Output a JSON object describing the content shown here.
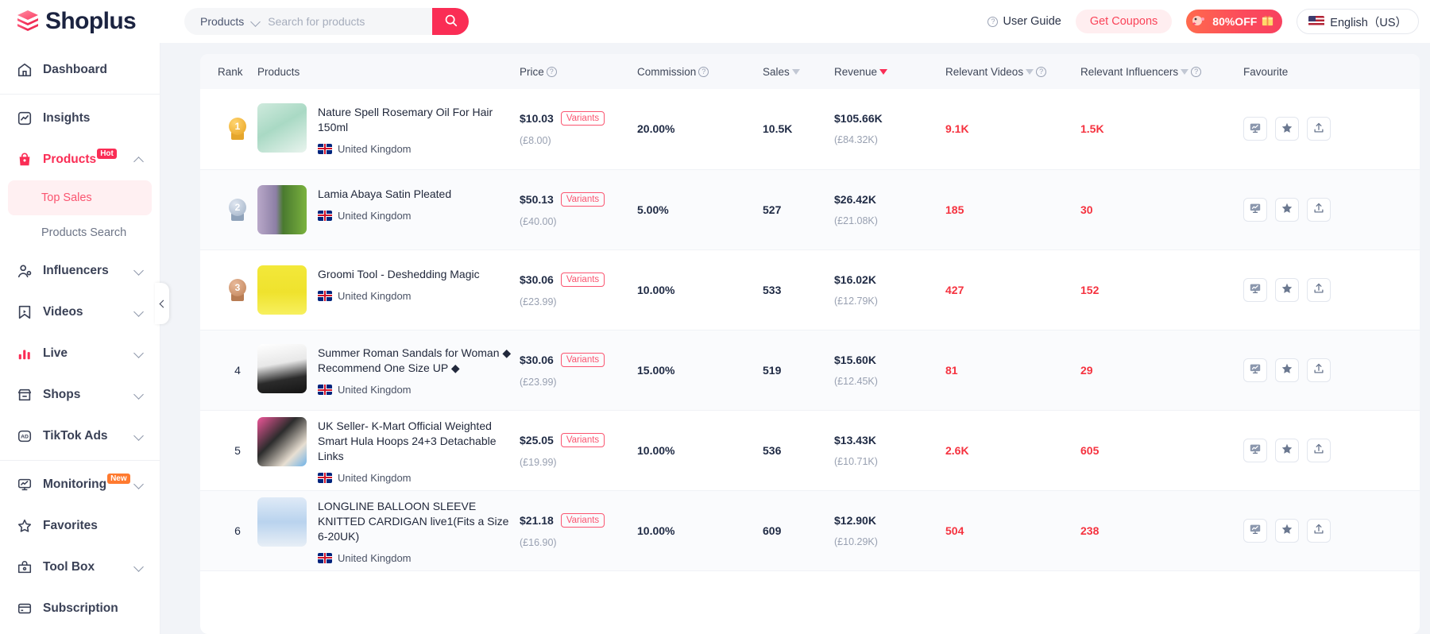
{
  "brand": {
    "name": "Shoplus"
  },
  "search": {
    "category": "Products",
    "placeholder": "Search for products",
    "value": "",
    "button_icon": "search-icon"
  },
  "header": {
    "user_guide": "User Guide",
    "get_coupons": "Get Coupons",
    "offer": "80%OFF",
    "language": "English（US）"
  },
  "sidebar": {
    "items": [
      {
        "label": "Dashboard",
        "icon": "home-icon",
        "badge": null,
        "expandable": false
      },
      {
        "label": "Insights",
        "icon": "insights-icon",
        "badge": null,
        "expandable": false
      },
      {
        "label": "Products",
        "icon": "bag-icon",
        "badge": "Hot",
        "expandable": true,
        "expanded": true,
        "active": true
      },
      {
        "label": "Influencers",
        "icon": "user-icon",
        "badge": null,
        "expandable": true
      },
      {
        "label": "Videos",
        "icon": "video-icon",
        "badge": null,
        "expandable": true
      },
      {
        "label": "Live",
        "icon": "live-bars-icon",
        "badge": null,
        "expandable": true
      },
      {
        "label": "Shops",
        "icon": "shop-icon",
        "badge": null,
        "expandable": true
      },
      {
        "label": "TikTok Ads",
        "icon": "ad-icon",
        "badge": null,
        "expandable": true
      },
      {
        "label": "Monitoring",
        "icon": "monitor-icon",
        "badge": "New",
        "expandable": true
      },
      {
        "label": "Favorites",
        "icon": "star-outline-icon",
        "badge": null,
        "expandable": false
      },
      {
        "label": "Tool Box",
        "icon": "toolbox-icon",
        "badge": null,
        "expandable": true
      },
      {
        "label": "Subscription",
        "icon": "card-icon",
        "badge": null,
        "expandable": false
      }
    ],
    "subitems": [
      {
        "label": "Top Sales",
        "selected": true
      },
      {
        "label": "Products Search",
        "selected": false
      }
    ]
  },
  "table": {
    "columns": [
      {
        "key": "rank",
        "label": "Rank",
        "help": false,
        "sort": null
      },
      {
        "key": "products",
        "label": "Products",
        "help": false,
        "sort": null
      },
      {
        "key": "price",
        "label": "Price",
        "help": true,
        "sort": null
      },
      {
        "key": "commission",
        "label": "Commission",
        "help": true,
        "sort": null
      },
      {
        "key": "sales",
        "label": "Sales",
        "help": false,
        "sort": "inactive"
      },
      {
        "key": "revenue",
        "label": "Revenue",
        "help": false,
        "sort": "active-desc"
      },
      {
        "key": "relevant_videos",
        "label": "Relevant Videos",
        "help": true,
        "sort": "inactive"
      },
      {
        "key": "relevant_influencers",
        "label": "Relevant Influencers",
        "help": true,
        "sort": "inactive"
      },
      {
        "key": "favourite",
        "label": "Favourite",
        "help": false,
        "sort": null
      }
    ],
    "variants_label": "Variants",
    "row_actions": [
      "monitor-icon",
      "star-icon",
      "export-icon"
    ],
    "rows": [
      {
        "rank": "1",
        "medal": "gold",
        "title": "Nature Spell Rosemary Oil For Hair 150ml",
        "country": "United Kingdom",
        "price_usd": "$10.03",
        "price_local": "(£8.00)",
        "commission": "20.00%",
        "sales": "10.5K",
        "revenue_usd": "$105.66K",
        "revenue_local": "(£84.32K)",
        "videos": "9.1K",
        "influencers": "1.5K"
      },
      {
        "rank": "2",
        "medal": "silver",
        "title": "Lamia Abaya Satin Pleated",
        "country": "United Kingdom",
        "price_usd": "$50.13",
        "price_local": "(£40.00)",
        "commission": "5.00%",
        "sales": "527",
        "revenue_usd": "$26.42K",
        "revenue_local": "(£21.08K)",
        "videos": "185",
        "influencers": "30"
      },
      {
        "rank": "3",
        "medal": "bronze",
        "title": "Groomi Tool - Deshedding Magic",
        "country": "United Kingdom",
        "price_usd": "$30.06",
        "price_local": "(£23.99)",
        "commission": "10.00%",
        "sales": "533",
        "revenue_usd": "$16.02K",
        "revenue_local": "(£12.79K)",
        "videos": "427",
        "influencers": "152"
      },
      {
        "rank": "4",
        "medal": null,
        "title": "Summer Roman Sandals for Woman ◆ Recommend One Size UP ◆",
        "country": "United Kingdom",
        "price_usd": "$30.06",
        "price_local": "(£23.99)",
        "commission": "15.00%",
        "sales": "519",
        "revenue_usd": "$15.60K",
        "revenue_local": "(£12.45K)",
        "videos": "81",
        "influencers": "29"
      },
      {
        "rank": "5",
        "medal": null,
        "title": "UK Seller- K-Mart Official Weighted Smart Hula Hoops 24+3 Detachable Links",
        "country": "United Kingdom",
        "price_usd": "$25.05",
        "price_local": "(£19.99)",
        "commission": "10.00%",
        "sales": "536",
        "revenue_usd": "$13.43K",
        "revenue_local": "(£10.71K)",
        "videos": "2.6K",
        "influencers": "605"
      },
      {
        "rank": "6",
        "medal": null,
        "title": "LONGLINE BALLOON SLEEVE KNITTED CARDIGAN live1(Fits a Size 6-20UK)",
        "country": "United Kingdom",
        "price_usd": "$21.18",
        "price_local": "(£16.90)",
        "commission": "10.00%",
        "sales": "609",
        "revenue_usd": "$12.90K",
        "revenue_local": "(£10.29K)",
        "videos": "504",
        "influencers": "238"
      }
    ]
  },
  "colors": {
    "accent": "#fa2d55",
    "red_num": "#f5323f",
    "text": "#1f2a44",
    "muted": "#98a0b1"
  }
}
